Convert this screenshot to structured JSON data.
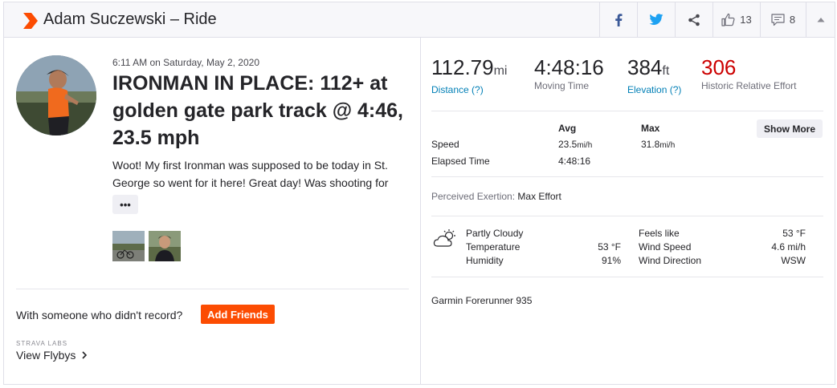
{
  "header": {
    "title": "Adam Suczewski – Ride",
    "kudos_count": "13",
    "comments_count": "8"
  },
  "activity": {
    "datetime": "6:11 AM on Saturday, May 2, 2020",
    "title": "IRONMAN IN PLACE: 112+ at golden gate park track @ 4:46, 23.5 mph",
    "description": "Woot! My first Ironman was supposed to be today in St. George so went for it here! Great day! Was shooting for",
    "more_label": "•••"
  },
  "social": {
    "with_someone": "With someone who didn't record?",
    "add_friends": "Add Friends",
    "labs": "STRAVA LABS",
    "flybys": "View Flybys"
  },
  "stats": {
    "distance_value": "112.79",
    "distance_unit": "mi",
    "distance_label": "Distance (?)",
    "moving_time_value": "4:48:16",
    "moving_time_label": "Moving Time",
    "elevation_value": "384",
    "elevation_unit": "ft",
    "elevation_label": "Elevation (?)",
    "effort_value": "306",
    "effort_label": "Historic Relative Effort"
  },
  "details": {
    "col_avg": "Avg",
    "col_max": "Max",
    "show_more": "Show More",
    "speed_label": "Speed",
    "speed_avg": "23.5",
    "speed_avg_unit": "mi/h",
    "speed_max": "31.8",
    "speed_max_unit": "mi/h",
    "elapsed_label": "Elapsed Time",
    "elapsed_value": "4:48:16",
    "exertion_label": "Perceived Exertion:",
    "exertion_value": "Max Effort"
  },
  "weather": {
    "condition": "Partly Cloudy",
    "temperature_label": "Temperature",
    "temperature_value": "53 °F",
    "humidity_label": "Humidity",
    "humidity_value": "91%",
    "feels_like_label": "Feels like",
    "feels_like_value": "53 °F",
    "wind_speed_label": "Wind Speed",
    "wind_speed_value": "4.6 mi/h",
    "wind_dir_label": "Wind Direction",
    "wind_dir_value": "WSW"
  },
  "device": "Garmin Forerunner 935",
  "colors": {
    "brand": "#fc4c02",
    "link": "#007fb6",
    "effort": "#cc0000",
    "facebook": "#3b5998",
    "twitter": "#1da1f2"
  }
}
